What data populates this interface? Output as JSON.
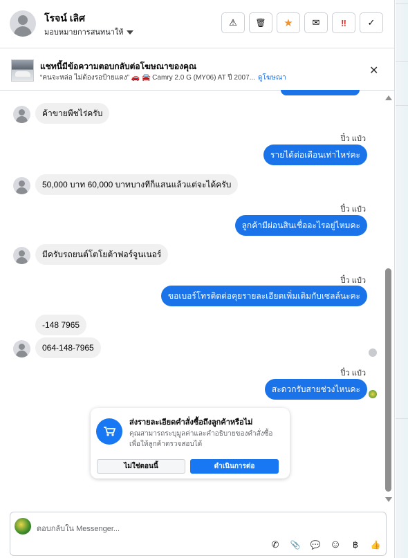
{
  "header": {
    "name": "โรจน์ เลิศ",
    "assign_label": "มอบหมายการสนทนาให้",
    "actions": [
      {
        "name": "spam-warning-button",
        "glyph": "⚠"
      },
      {
        "name": "delete-button",
        "glyph": "🗑"
      },
      {
        "name": "star-button",
        "glyph": "★"
      },
      {
        "name": "mark-unread-button",
        "glyph": "✉"
      },
      {
        "name": "flag-button",
        "glyph": "‼"
      },
      {
        "name": "done-button",
        "glyph": "✓"
      }
    ],
    "colors": {
      "star": "#f0932b",
      "flag": "#d93025"
    }
  },
  "ad": {
    "title": "แชทนี้มีข้อความตอบกลับต่อโฆษณาของคุณ",
    "subtitle": "“คนจะหล่อ ไม่ต้องรอป้ายแดง” 🚗 🚘 Camry 2.0 G (MY06) AT ปี 2007...",
    "link": "ดูโฆษณา",
    "close_glyph": "✕"
  },
  "messages": [
    {
      "dir": "in",
      "text": "ค้าขายพืชไร่ครับ"
    },
    {
      "dir": "out",
      "sender": "ปิ๋ว แป๋ว",
      "text": "รายได้ต่อเดือนเท่าไหร่คะ"
    },
    {
      "dir": "in",
      "text": "50,000 บาท 60,000 บาทบางทีก็แสนแล้วแต่จะได้ครับ"
    },
    {
      "dir": "out",
      "sender": "ปิ๋ว แป๋ว",
      "text": "ลูกค้ามีผ่อนสินเชื่ออะไรอยู่ไหมคะ"
    },
    {
      "dir": "in",
      "text": "มีครับรถยนต์โตโยต้าฟอร์จูนเนอร์"
    },
    {
      "dir": "out",
      "sender": "ปิ๋ว แป๋ว",
      "text": "ขอเบอร์โทรติดต่อคุยรายละเอียดเพิ่มเติมกับเซลล์นะคะ"
    },
    {
      "dir": "in",
      "text": "-148 7965"
    },
    {
      "dir": "in",
      "text": "064-148-7965"
    },
    {
      "dir": "out",
      "sender": "ปิ๋ว แป๋ว",
      "text": "สะดวกรับสายช่วงไหนคะ"
    }
  ],
  "order_prompt": {
    "title": "ส่งรายละเอียดคำสั่งซื้อถึงลูกค้าหรือไม่",
    "description": "คุณสามารถระบุมูลค่าและคำอธิบายของคำสั่งซื้อเพื่อให้ลูกค้าตรวจสอบได้",
    "no_label": "ไม่ใช่ตอนนี้",
    "yes_label": "ดำเนินการต่อ",
    "icon": "cart-icon"
  },
  "composer": {
    "placeholder": "ตอบกลับใน Messenger...",
    "tools": [
      {
        "name": "call-icon",
        "glyph": "✆"
      },
      {
        "name": "attach-icon",
        "glyph": "📎"
      },
      {
        "name": "saved-reply-icon",
        "glyph": "💬"
      },
      {
        "name": "emoji-icon",
        "glyph": "☺"
      },
      {
        "name": "payment-icon",
        "glyph": "฿"
      },
      {
        "name": "thumbs-up-icon",
        "glyph": "👍"
      }
    ]
  },
  "colors": {
    "outgoing_bubble": "#1a73e8",
    "incoming_bubble": "#f0f0f0",
    "primary_button": "#1877f2"
  }
}
